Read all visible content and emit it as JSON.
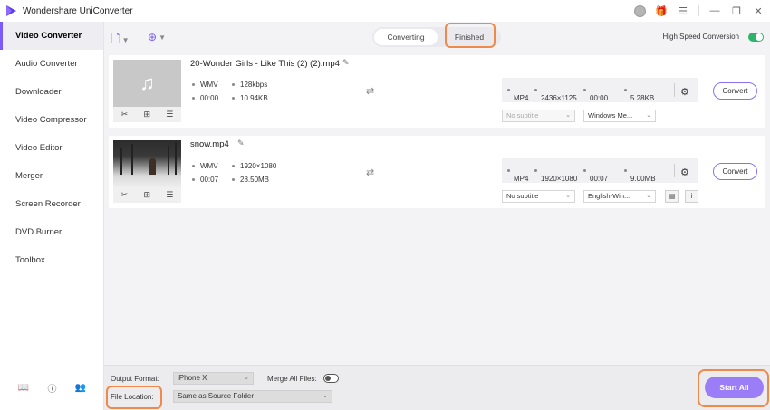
{
  "app": {
    "title": "Wondershare UniConverter"
  },
  "colors": {
    "accent": "#7a5af8",
    "highlight": "#f08a4b",
    "toggle_on": "#2fb36a"
  },
  "sidebar": {
    "items": [
      {
        "label": "Video Converter",
        "active": true
      },
      {
        "label": "Audio Converter"
      },
      {
        "label": "Downloader"
      },
      {
        "label": "Video Compressor"
      },
      {
        "label": "Video Editor"
      },
      {
        "label": "Merger"
      },
      {
        "label": "Screen Recorder"
      },
      {
        "label": "DVD Burner"
      },
      {
        "label": "Toolbox"
      }
    ],
    "bottom_icons": [
      "book-icon",
      "help-icon",
      "user-group-icon"
    ]
  },
  "toolbar": {
    "tabs": {
      "converting": "Converting",
      "finished": "Finished"
    },
    "high_speed_label": "High Speed Conversion",
    "high_speed_on": true
  },
  "files": [
    {
      "name": "20-Wonder Girls - Like This (2) (2).mp4",
      "src_format": "WMV",
      "src_bitrate": "128kbps",
      "src_duration": "00:00",
      "src_size": "10.94KB",
      "out_format": "MP4",
      "out_resolution": "2436×1125",
      "out_duration": "00:00",
      "out_size": "5.28KB",
      "subtitle": "No subtitle",
      "audio": "Windows Me...",
      "convert_label": "Convert"
    },
    {
      "name": "snow.mp4",
      "src_format": "WMV",
      "src_resolution": "1920×1080",
      "src_duration": "00:07",
      "src_size": "28.50MB",
      "out_format": "MP4",
      "out_resolution": "1920×1080",
      "out_duration": "00:07",
      "out_size": "9.00MB",
      "subtitle": "No subtitle",
      "audio": "English-Win...",
      "convert_label": "Convert"
    }
  ],
  "bottom": {
    "output_format_label": "Output Format:",
    "output_format_value": "iPhone X",
    "merge_label": "Merge All Files:",
    "merge_on": false,
    "file_location_label": "File Location:",
    "file_location_value": "Same as Source Folder",
    "start_all_label": "Start All"
  }
}
